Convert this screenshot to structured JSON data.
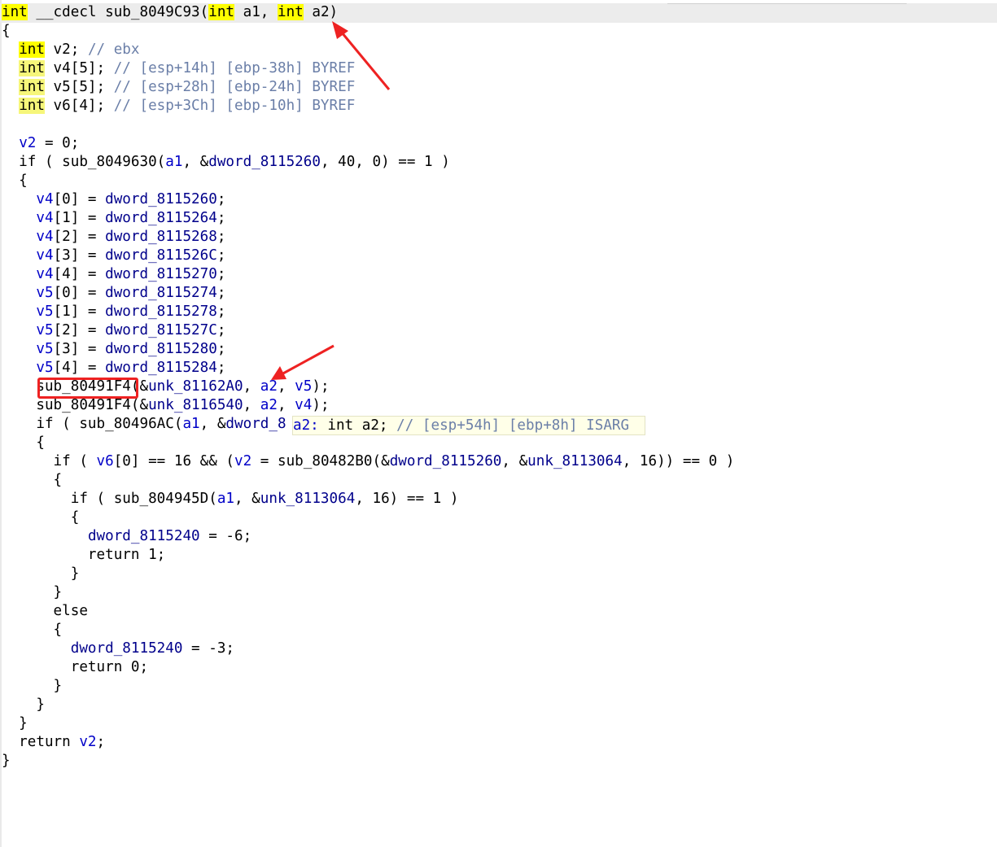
{
  "code": {
    "l0": [
      "int",
      " __cdecl sub_8049C93(",
      "int",
      " a1, ",
      "int",
      " a2)"
    ],
    "l1": "{",
    "l2": [
      "  ",
      "int",
      " v2; ",
      "// ebx"
    ],
    "l3": [
      "  ",
      "int",
      " v4[5]; ",
      "// [esp+14h] [ebp-38h] BYREF"
    ],
    "l4": [
      "  ",
      "int",
      " v5[5]; ",
      "// [esp+28h] [ebp-24h] BYREF"
    ],
    "l5": [
      "  ",
      "int",
      " v6[4]; ",
      "// [esp+3Ch] [ebp-10h] BYREF"
    ],
    "l6": "",
    "l7": [
      "  ",
      "v2",
      " = 0;"
    ],
    "l8": [
      "  if ( sub_8049630(",
      "a1",
      ", &",
      "dword_8115260",
      ", 40, 0) == 1 )"
    ],
    "l9": "  {",
    "l10": [
      "    ",
      "v4",
      "[0] = ",
      "dword_8115260",
      ";"
    ],
    "l11": [
      "    ",
      "v4",
      "[1] = ",
      "dword_8115264",
      ";"
    ],
    "l12": [
      "    ",
      "v4",
      "[2] = ",
      "dword_8115268",
      ";"
    ],
    "l13": [
      "    ",
      "v4",
      "[3] = ",
      "dword_811526C",
      ";"
    ],
    "l14": [
      "    ",
      "v4",
      "[4] = ",
      "dword_8115270",
      ";"
    ],
    "l15": [
      "    ",
      "v5",
      "[0] = ",
      "dword_8115274",
      ";"
    ],
    "l16": [
      "    ",
      "v5",
      "[1] = ",
      "dword_8115278",
      ";"
    ],
    "l17": [
      "    ",
      "v5",
      "[2] = ",
      "dword_811527C",
      ";"
    ],
    "l18": [
      "    ",
      "v5",
      "[3] = ",
      "dword_8115280",
      ";"
    ],
    "l19": [
      "    ",
      "v5",
      "[4] = ",
      "dword_8115284",
      ";"
    ],
    "l20": [
      "    sub_80491F4(&",
      "unk_81162A0",
      ", ",
      "a2",
      ", ",
      "v5",
      ");"
    ],
    "l21": [
      "    sub_80491F4(&",
      "unk_8116540",
      ", ",
      "a2",
      ", ",
      "v4",
      ");"
    ],
    "l22": [
      "    if ( sub_80496AC(",
      "a1",
      ", &",
      "dword_8"
    ],
    "l23": "    {",
    "l24": [
      "      if ( ",
      "v6",
      "[0] == 16 && (",
      "v2",
      " = sub_80482B0(&",
      "dword_8115260",
      ", &",
      "unk_8113064",
      ", 16)) == 0 )"
    ],
    "l25": "      {",
    "l26": [
      "        if ( sub_804945D(",
      "a1",
      ", &",
      "unk_8113064",
      ", 16) == 1 )"
    ],
    "l27": "        {",
    "l28": [
      "          ",
      "dword_8115240",
      " = -6;"
    ],
    "l29": "          return 1;",
    "l30": "        }",
    "l31": "      }",
    "l32": "      else",
    "l33": "      {",
    "l34": [
      "        ",
      "dword_8115240",
      " = -3;"
    ],
    "l35": "        return 0;",
    "l36": "      }",
    "l37": "    }",
    "l38": "  }",
    "l39": [
      "  return ",
      "v2",
      ";"
    ],
    "l40": "}"
  },
  "tooltip": {
    "name": "a2:",
    "type": " int a2; ",
    "comment": "// [esp+54h] [ebp+8h] ISARG"
  },
  "colors": {
    "keyword_highlight": "#f6f67a",
    "variable": "#0000c8",
    "global": "#00008b",
    "comment": "#6b7fa8",
    "annotation_red": "#ee2222"
  }
}
